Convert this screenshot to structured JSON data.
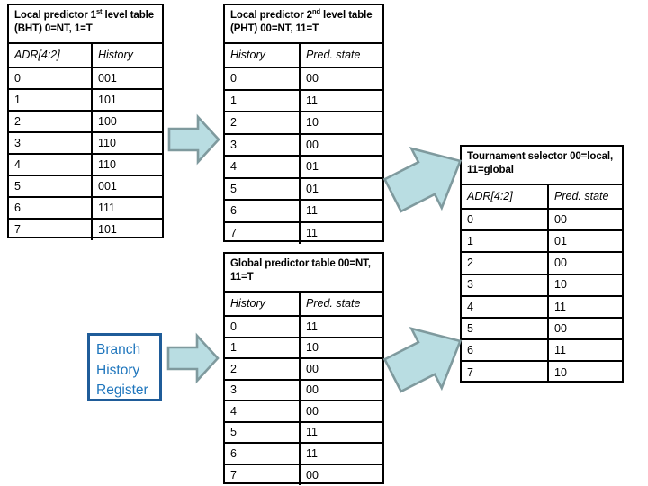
{
  "diagram": {
    "title_semantic": "tournament-branch-predictor-tables",
    "accent_arrow_fill": "#b9dde2",
    "accent_arrow_stroke": "#7f9a9e",
    "bhr_border_color": "#1f5c99",
    "bhr_text_color": "#1f76bd"
  },
  "bhr": {
    "line1": "Branch",
    "line2": "History",
    "line3": "Register"
  },
  "tables": {
    "bht": {
      "caption_pre": "Local predictor 1",
      "caption_sup": "st",
      "caption_post": " level table (BHT) 0=NT, 1=T",
      "headers": [
        "ADR[4:2]",
        "History"
      ],
      "header_colors": [
        "#2e8b74",
        "#8d2b34"
      ],
      "rows": [
        [
          "0",
          "001"
        ],
        [
          "1",
          "101"
        ],
        [
          "2",
          "100"
        ],
        [
          "3",
          "110"
        ],
        [
          "4",
          "110"
        ],
        [
          "5",
          "001"
        ],
        [
          "6",
          "111"
        ],
        [
          "7",
          "101"
        ]
      ]
    },
    "pht": {
      "caption_pre": "Local predictor 2",
      "caption_sup": "nd",
      "caption_post": " level table (PHT) 00=NT, 11=T",
      "headers": [
        "History",
        "Pred. state"
      ],
      "header_colors": [
        "#8d2b34",
        "#000000"
      ],
      "rows": [
        [
          "0",
          "00"
        ],
        [
          "1",
          "11"
        ],
        [
          "2",
          "10"
        ],
        [
          "3",
          "00"
        ],
        [
          "4",
          "01"
        ],
        [
          "5",
          "01"
        ],
        [
          "6",
          "11"
        ],
        [
          "7",
          "11"
        ]
      ]
    },
    "global": {
      "caption": "Global predictor table 00=NT, 11=T",
      "headers": [
        "History",
        "Pred. state"
      ],
      "header_colors": [
        "#49a5c4",
        "#000000"
      ],
      "rows": [
        [
          "0",
          "11"
        ],
        [
          "1",
          "10"
        ],
        [
          "2",
          "00"
        ],
        [
          "3",
          "00"
        ],
        [
          "4",
          "00"
        ],
        [
          "5",
          "11"
        ],
        [
          "6",
          "11"
        ],
        [
          "7",
          "00"
        ]
      ]
    },
    "tournament": {
      "caption": "Tournament selector 00=local, 11=global",
      "headers": [
        "ADR[4:2]",
        "Pred. state"
      ],
      "header_colors": [
        "#2e8b74",
        "#000000"
      ],
      "rows": [
        [
          "0",
          "00"
        ],
        [
          "1",
          "01"
        ],
        [
          "2",
          "00"
        ],
        [
          "3",
          "10"
        ],
        [
          "4",
          "11"
        ],
        [
          "5",
          "00"
        ],
        [
          "6",
          "11"
        ],
        [
          "7",
          "10"
        ]
      ]
    }
  },
  "arrows": [
    {
      "name": "arrow-bht-to-pht",
      "direction": "right"
    },
    {
      "name": "arrow-pht-to-tournament",
      "direction": "up-right"
    },
    {
      "name": "arrow-bhr-to-global",
      "direction": "right"
    },
    {
      "name": "arrow-global-to-tournament",
      "direction": "up-right"
    }
  ]
}
